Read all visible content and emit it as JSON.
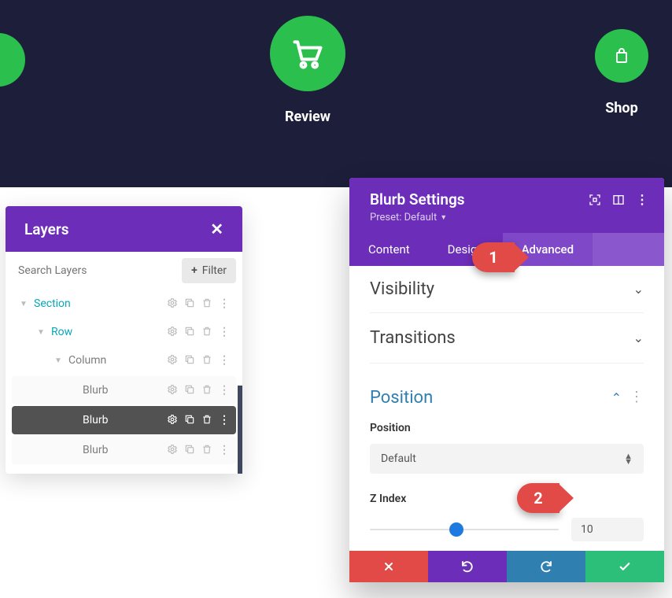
{
  "hero": {
    "review_label": "Review",
    "shop_label": "Shop"
  },
  "layers": {
    "title": "Layers",
    "search_placeholder": "Search Layers",
    "filter_label": "Filter",
    "tree": {
      "section": "Section",
      "row": "Row",
      "column": "Column",
      "blurb1": "Blurb",
      "blurb2": "Blurb",
      "blurb3": "Blurb"
    }
  },
  "settings": {
    "title": "Blurb Settings",
    "preset_label": "Preset: Default",
    "tabs": {
      "content": "Content",
      "design": "Design",
      "advanced": "Advanced"
    },
    "sections": {
      "visibility": "Visibility",
      "transitions": "Transitions",
      "position": "Position"
    },
    "position": {
      "field_label": "Position",
      "value": "Default",
      "z_label": "Z Index",
      "z_value": "10"
    }
  },
  "callouts": {
    "one": "1",
    "two": "2"
  }
}
